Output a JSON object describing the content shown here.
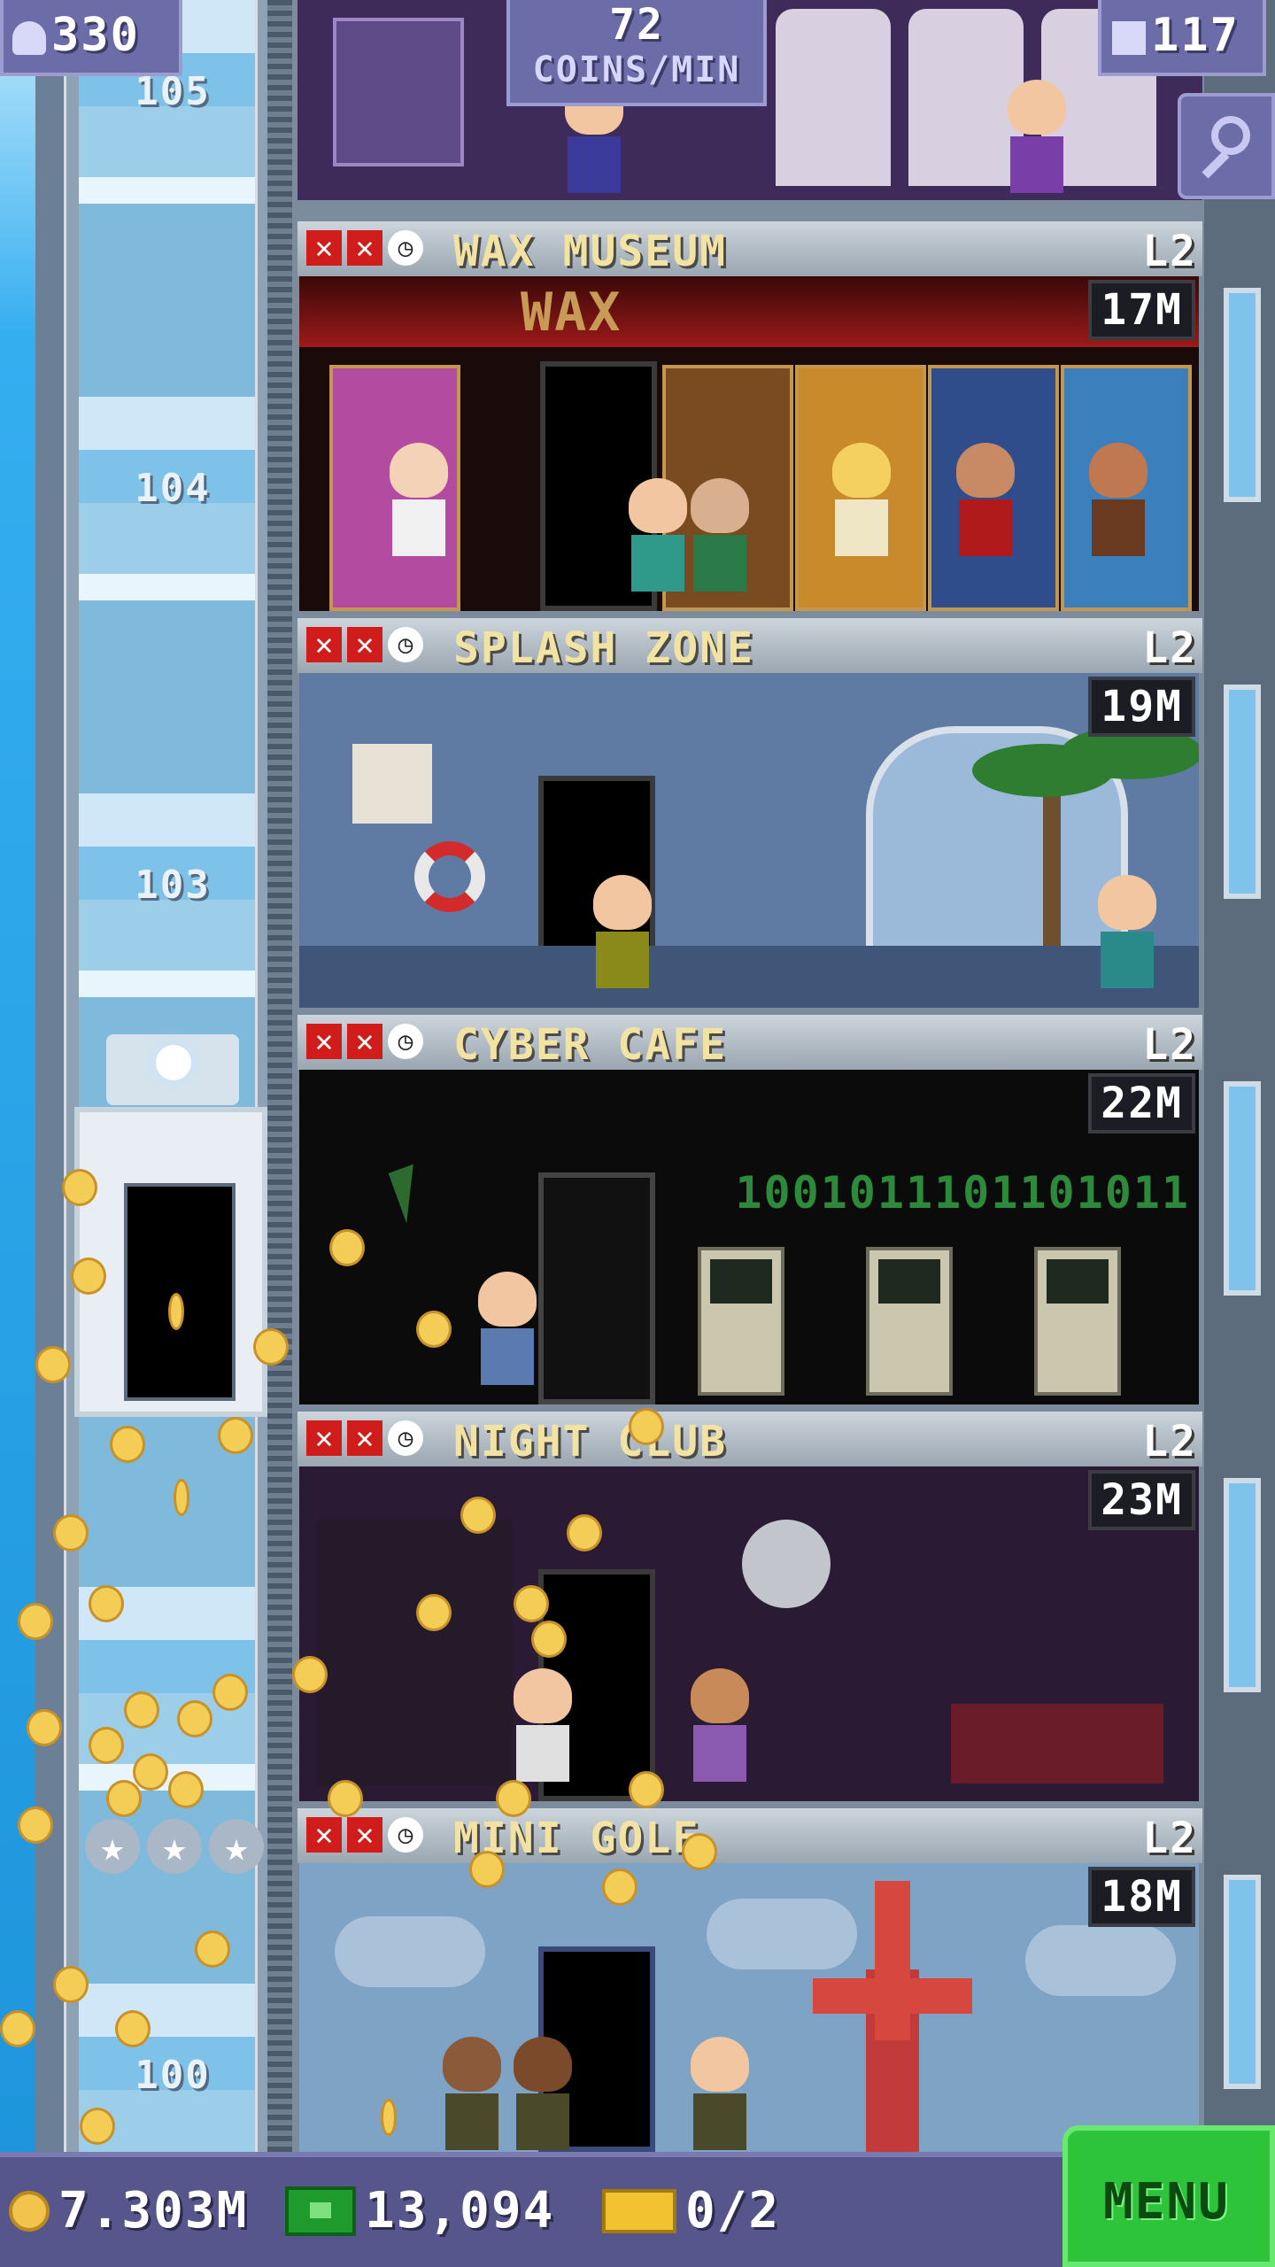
{
  "hud": {
    "population": "330",
    "coins_per_min_value": "72",
    "coins_per_min_label": "COINS/MIN",
    "floor_count": "117"
  },
  "shaft": {
    "floor_numbers": [
      "105",
      "104",
      "103",
      "100"
    ]
  },
  "top_floor": {},
  "floors": [
    {
      "name": "WAX MUSEUM",
      "level": "L2",
      "price": "17M",
      "sign": "WAX"
    },
    {
      "name": "SPLASH ZONE",
      "level": "L2",
      "price": "19M"
    },
    {
      "name": "CYBER CAFE",
      "level": "L2",
      "price": "22M",
      "binary": "1001011101101011"
    },
    {
      "name": "NIGHT CLUB",
      "level": "L2",
      "price": "23M"
    },
    {
      "name": "MINI GOLF",
      "level": "L2",
      "price": "18M"
    }
  ],
  "bottom_bar": {
    "coins": "7.303M",
    "tower_bux": "13,094",
    "tickets": "0/2",
    "menu_label": "MENU"
  },
  "icons": {
    "population": "person-icon",
    "floors": "building-icon",
    "search": "magnifier-icon",
    "coins": "coin-icon",
    "bux": "tower-bux-icon",
    "tickets": "ticket-icon",
    "restock": "x-icon",
    "timer": "clock-icon",
    "rating": "star-icon"
  },
  "colors": {
    "hud_panel": "#6c6ca8",
    "menu_green": "#2dc33a",
    "floor_name": "#f3e3a3",
    "sky": "#2aa3e6"
  }
}
